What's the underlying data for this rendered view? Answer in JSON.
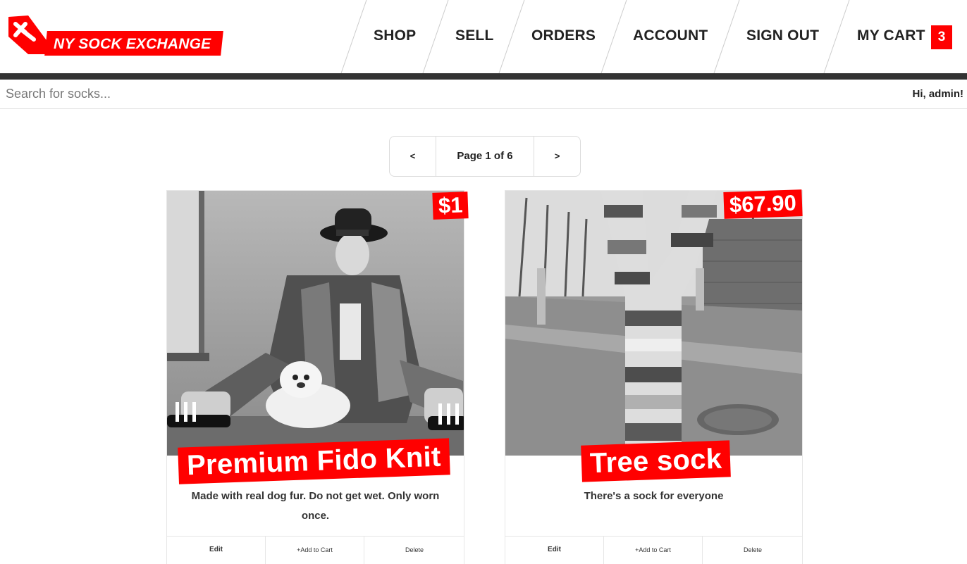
{
  "brand": {
    "name": "NY SOCK EXCHANGE",
    "accent_color": "#ff0000",
    "logo_icon": "sock-exchange-logo-icon"
  },
  "nav": {
    "items": [
      {
        "label": "SHOP"
      },
      {
        "label": "SELL"
      },
      {
        "label": "ORDERS"
      },
      {
        "label": "ACCOUNT"
      },
      {
        "label": "SIGN OUT"
      },
      {
        "label": "MY CART"
      }
    ],
    "cart_count": "3"
  },
  "search": {
    "placeholder": "Search for socks...",
    "value": ""
  },
  "user": {
    "greeting": "Hi, admin!"
  },
  "pagination": {
    "prev_label": "<",
    "next_label": ">",
    "page_label": "Page 1 of 6"
  },
  "products": [
    {
      "title": "Premium Fido Knit",
      "price": "$1",
      "description": "Made with real dog fur. Do not get wet. Only worn once.",
      "image_alt": "photo-man-with-dog",
      "actions": {
        "edit": "Edit",
        "add": "+Add to Cart",
        "delete": "Delete"
      }
    },
    {
      "title": "Tree sock",
      "price": "$67.90",
      "description": "There's a sock for everyone",
      "image_alt": "photo-knitted-tree",
      "actions": {
        "edit": "Edit",
        "add": "+Add to Cart",
        "delete": "Delete"
      }
    }
  ]
}
